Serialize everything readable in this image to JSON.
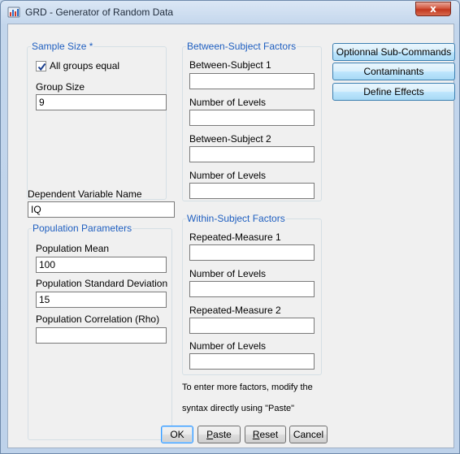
{
  "window": {
    "title": "GRD - Generator of Random Data",
    "close_label": "x"
  },
  "sample_size": {
    "legend": "Sample Size *",
    "all_groups_equal_label": "All groups equal",
    "all_groups_equal_checked": true,
    "group_size_label": "Group Size",
    "group_size_value": "9"
  },
  "dependent_variable": {
    "label": "Dependent Variable Name",
    "value": "IQ"
  },
  "population_parameters": {
    "legend": "Population Parameters",
    "mean_label": "Population Mean",
    "mean_value": "100",
    "sd_label": "Population Standard Deviation",
    "sd_value": "15",
    "rho_label": "Population Correlation (Rho)",
    "rho_value": ""
  },
  "between_subject_factors": {
    "legend": "Between-Subject Factors",
    "factor1_label": "Between-Subject 1",
    "factor1_value": "",
    "levels1_label": "Number of Levels",
    "levels1_value": "",
    "factor2_label": "Between-Subject 2",
    "factor2_value": "",
    "levels2_label": "Number of Levels",
    "levels2_value": ""
  },
  "within_subject_factors": {
    "legend": "Within-Subject Factors",
    "factor1_label": "Repeated-Measure 1",
    "factor1_value": "",
    "levels1_label": "Number of Levels",
    "levels1_value": "",
    "factor2_label": "Repeated-Measure 2",
    "factor2_value": "",
    "levels2_label": "Number of Levels",
    "levels2_value": ""
  },
  "hint": {
    "line1": "To enter more factors, modify the",
    "line2": "syntax directly using \"Paste\""
  },
  "side_buttons": {
    "optional": "Optionnal Sub-Commands",
    "contaminants": "Contaminants",
    "define_effects": "Define Effects"
  },
  "footer_buttons": {
    "ok": "OK",
    "paste_mnemonic": "P",
    "paste_rest": "aste",
    "reset_mnemonic": "R",
    "reset_rest": "eset",
    "cancel": "Cancel"
  },
  "colors": {
    "legend_text": "#1f5fc0",
    "close_button": "#c2381f",
    "accent_button": "#bee6fd"
  }
}
